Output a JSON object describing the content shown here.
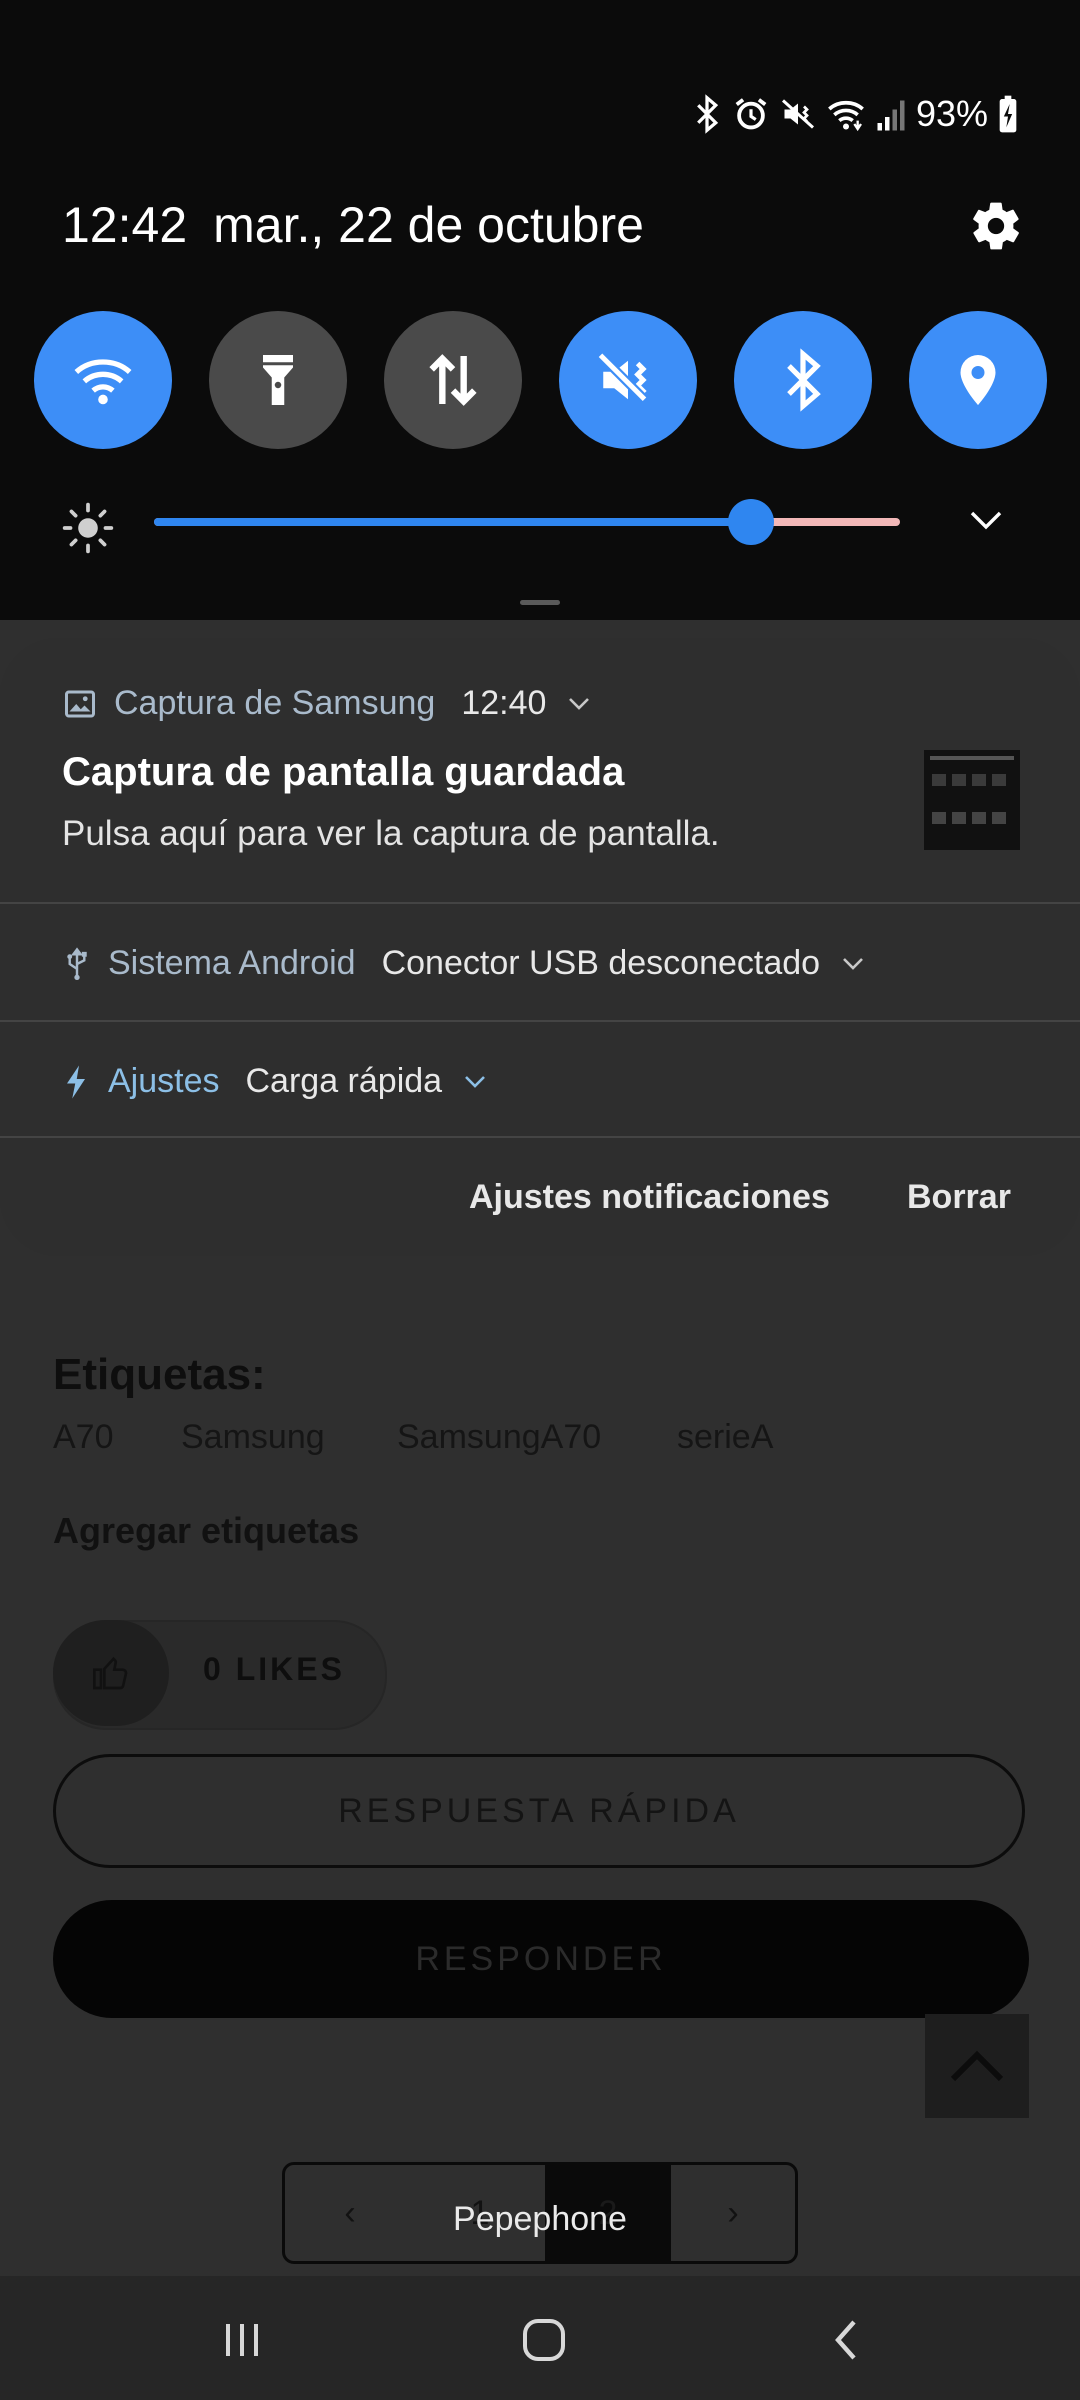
{
  "status_bar": {
    "battery_percent": "93%",
    "icons": [
      "bluetooth-icon",
      "alarm-icon",
      "mute-icon",
      "wifi-icon",
      "signal-icon",
      "battery-charging-icon"
    ]
  },
  "header": {
    "time": "12:42",
    "date": "mar., 22 de octubre",
    "settings_icon": "gear-icon"
  },
  "quick_toggles": [
    {
      "name": "wifi",
      "icon": "wifi-icon",
      "state": "on"
    },
    {
      "name": "flashlight",
      "icon": "flashlight-icon",
      "state": "off"
    },
    {
      "name": "mobile-data",
      "icon": "data-arrows-icon",
      "state": "off"
    },
    {
      "name": "sound",
      "icon": "mute-icon",
      "state": "on"
    },
    {
      "name": "bluetooth",
      "icon": "bluetooth-icon",
      "state": "on"
    },
    {
      "name": "location",
      "icon": "location-pin-icon",
      "state": "on"
    }
  ],
  "brightness": {
    "level": 0.8
  },
  "notifications": [
    {
      "app": "Captura de Samsung",
      "time": "12:40",
      "title": "Captura de pantalla guardada",
      "text": "Pulsa aquí para ver la captura de pantalla.",
      "icon": "image-icon"
    },
    {
      "app": "Sistema Android",
      "summary": "Conector USB desconectado",
      "icon": "usb-icon"
    },
    {
      "app": "Ajustes",
      "summary": "Carga rápida",
      "icon": "bolt-icon"
    }
  ],
  "notification_footer": {
    "settings_label": "Ajustes notificaciones",
    "clear_label": "Borrar"
  },
  "background_page": {
    "tags_title": "Etiquetas:",
    "tags": [
      "A70",
      "Samsung",
      "SamsungA70",
      "serieA"
    ],
    "add_tags": "Agregar etiquetas",
    "likes": "0 LIKES",
    "quick_reply": "RESPUESTA RÁPIDA",
    "reply": "RESPONDER",
    "pager": {
      "prev": "‹",
      "pages": [
        "1",
        "2"
      ],
      "next": "›"
    }
  },
  "carrier": "Pepephone",
  "colors": {
    "accent": "#3d8ef7",
    "toggle_off": "#4a4a4a",
    "card": "#2e2e2e"
  }
}
